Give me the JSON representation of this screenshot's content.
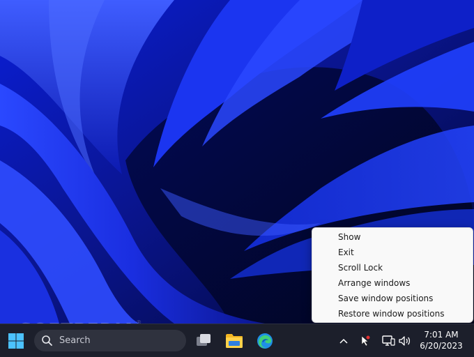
{
  "context_menu": {
    "items": [
      {
        "label": "Show"
      },
      {
        "label": "Exit"
      },
      {
        "label": "Scroll Lock"
      },
      {
        "label": "Arrange windows"
      },
      {
        "label": "Save window positions"
      },
      {
        "label": "Restore window positions"
      }
    ]
  },
  "watermark": {
    "text": "SOFTPEDIA",
    "mark": "®"
  },
  "taskbar": {
    "start_icon": "windows-logo-icon",
    "search": {
      "label": "Search",
      "icon": "search-icon"
    },
    "apps": [
      {
        "icon": "task-view-icon"
      },
      {
        "icon": "file-explorer-icon"
      },
      {
        "icon": "edge-browser-icon"
      }
    ],
    "tray": {
      "icons": [
        "chevron-up-icon",
        "cursor-app-icon",
        "network-icon",
        "volume-icon"
      ],
      "time": "7:01 AM",
      "date": "6/20/2023"
    }
  },
  "colors": {
    "taskbar_bg": "#1c1f2b",
    "menu_bg": "#f9f9f9",
    "wallpaper_blue": "#1d35e8",
    "accent": "#0a84ff"
  }
}
